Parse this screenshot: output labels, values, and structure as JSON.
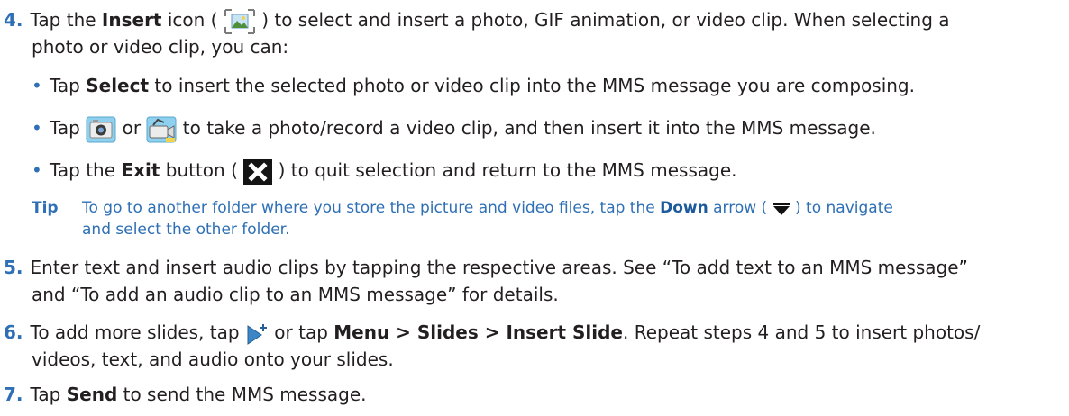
{
  "step4": {
    "num": "4.",
    "l1_a": "Tap the ",
    "l1_b": "Insert",
    "l1_c": " icon ( ",
    "l1_d": " ) to select and insert a photo, GIF animation, or video clip. When selecting a",
    "l2": "photo or video clip, you can:",
    "bullet1_a": "Tap ",
    "bullet1_b": "Select",
    "bullet1_c": " to insert the selected photo or video clip into the MMS message you are composing.",
    "bullet2_a": "Tap ",
    "bullet2_b": " or ",
    "bullet2_c": " to take a photo/record a video clip, and then insert it into the MMS message.",
    "bullet3_a": "Tap the ",
    "bullet3_b": "Exit",
    "bullet3_c": " button ( ",
    "bullet3_d": " ) to quit selection and return to the MMS message.",
    "tip_label": "Tip",
    "tip_a": "To go to another folder where you store the picture and video files, tap the ",
    "tip_b": "Down",
    "tip_c": " arrow ( ",
    "tip_d": " ) to navigate",
    "tip_l2": "and select the other folder."
  },
  "step5": {
    "num": "5.",
    "l1": "Enter text and insert audio clips by tapping the respective areas. See “To add text to an MMS message”",
    "l2": "and “To add an audio clip to an MMS message” for details."
  },
  "step6": {
    "num": "6.",
    "l1_a": "To add more slides, tap ",
    "l1_b": " or tap ",
    "l1_c": "Menu > Slides > Insert Slide",
    "l1_d": ". Repeat steps 4 and 5 to insert photos/",
    "l2": "videos, text, and audio onto your slides."
  },
  "step7": {
    "num": "7.",
    "l1_a": "Tap ",
    "l1_b": "Send",
    "l1_c": " to send the MMS message."
  },
  "icons": {
    "insert": "insert-picture-icon",
    "camera": "camera-icon",
    "video": "video-camera-icon",
    "exit": "exit-x-icon",
    "down": "down-arrow-icon",
    "slide": "insert-slide-icon"
  }
}
